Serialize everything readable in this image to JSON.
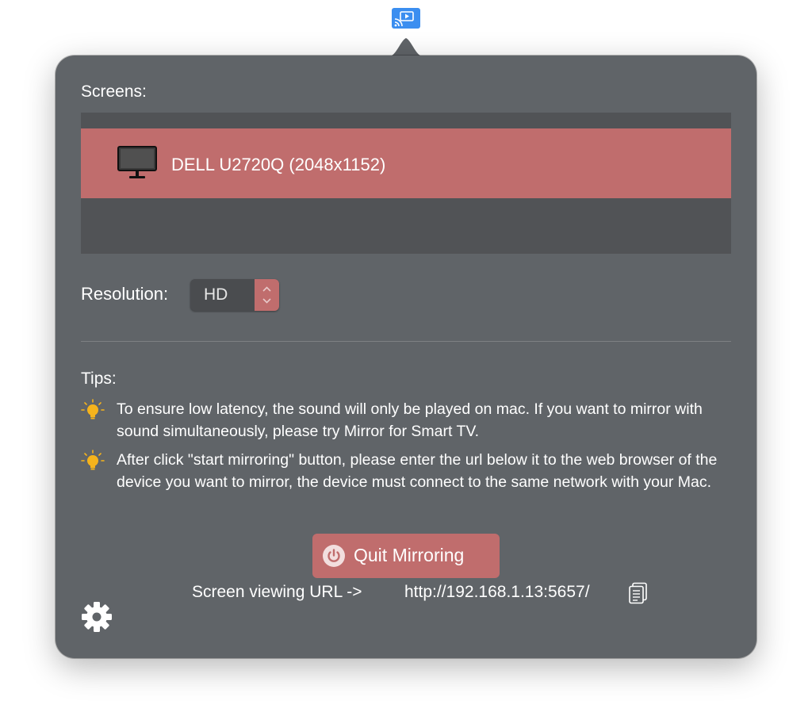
{
  "menubar": {
    "icon": "screen-cast-icon",
    "accent": "#3b8ef0"
  },
  "screens": {
    "label": "Screens:",
    "items": [
      {
        "icon": "monitor-icon",
        "name": "DELL U2720Q (2048x1152)",
        "selected": true
      }
    ]
  },
  "resolution": {
    "label": "Resolution:",
    "value": "HD"
  },
  "tips": {
    "label": "Tips:",
    "items": [
      {
        "icon": "lightbulb-icon",
        "text": "To ensure low latency, the sound will only be played on mac. If you want to mirror with sound simultaneously, please try Mirror for Smart TV."
      },
      {
        "icon": "lightbulb-icon",
        "text": "After click \"start mirroring\" button, please enter the url below it to the web browser of the device you want to mirror, the device must connect to the same network with your Mac."
      }
    ]
  },
  "quit_button": {
    "label": "Quit Mirroring",
    "icon": "power-icon"
  },
  "url": {
    "prefix": "Screen viewing URL ->",
    "value": "http://192.168.1.13:5657/",
    "copy_icon": "copy-icon"
  },
  "settings": {
    "icon": "gear-icon"
  },
  "colors": {
    "panel": "#606468",
    "accent": "#c06d6d",
    "list_bg": "#515356",
    "bulb": "#f5b31c"
  }
}
